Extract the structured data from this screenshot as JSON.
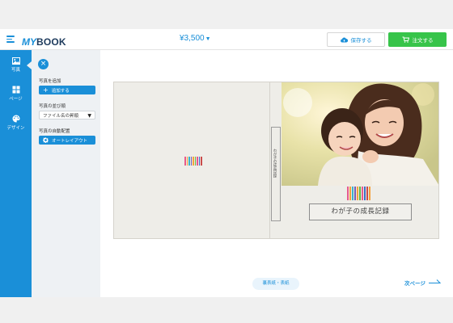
{
  "header": {
    "logo_my": "MY",
    "logo_book": "BOOK",
    "logo_sub": "",
    "price": "¥3,500",
    "save_label": "保存する",
    "order_label": "注文する"
  },
  "sidebar": {
    "items": [
      {
        "label": "写真",
        "icon": "image-icon",
        "active": true
      },
      {
        "label": "ページ",
        "icon": "grid-icon",
        "active": false
      },
      {
        "label": "デザイン",
        "icon": "palette-icon",
        "active": false
      }
    ]
  },
  "panel": {
    "add_photo_label": "写真を追加",
    "add_button": "追加する",
    "sort_label": "写真の並び順",
    "sort_value": "ファイル名の昇順",
    "auto_label": "写真の自動配置",
    "auto_button": "オートレイアウト"
  },
  "book": {
    "spine_text": "わが子の成長記録",
    "cover_title": "わが子の成長記録"
  },
  "footer": {
    "page_pill": "裏表紙・表紙",
    "next_label": "次ページ"
  },
  "colors": {
    "accent": "#1a8fd8",
    "order_green": "#37c44a",
    "cover_bg": "#eeede8"
  }
}
